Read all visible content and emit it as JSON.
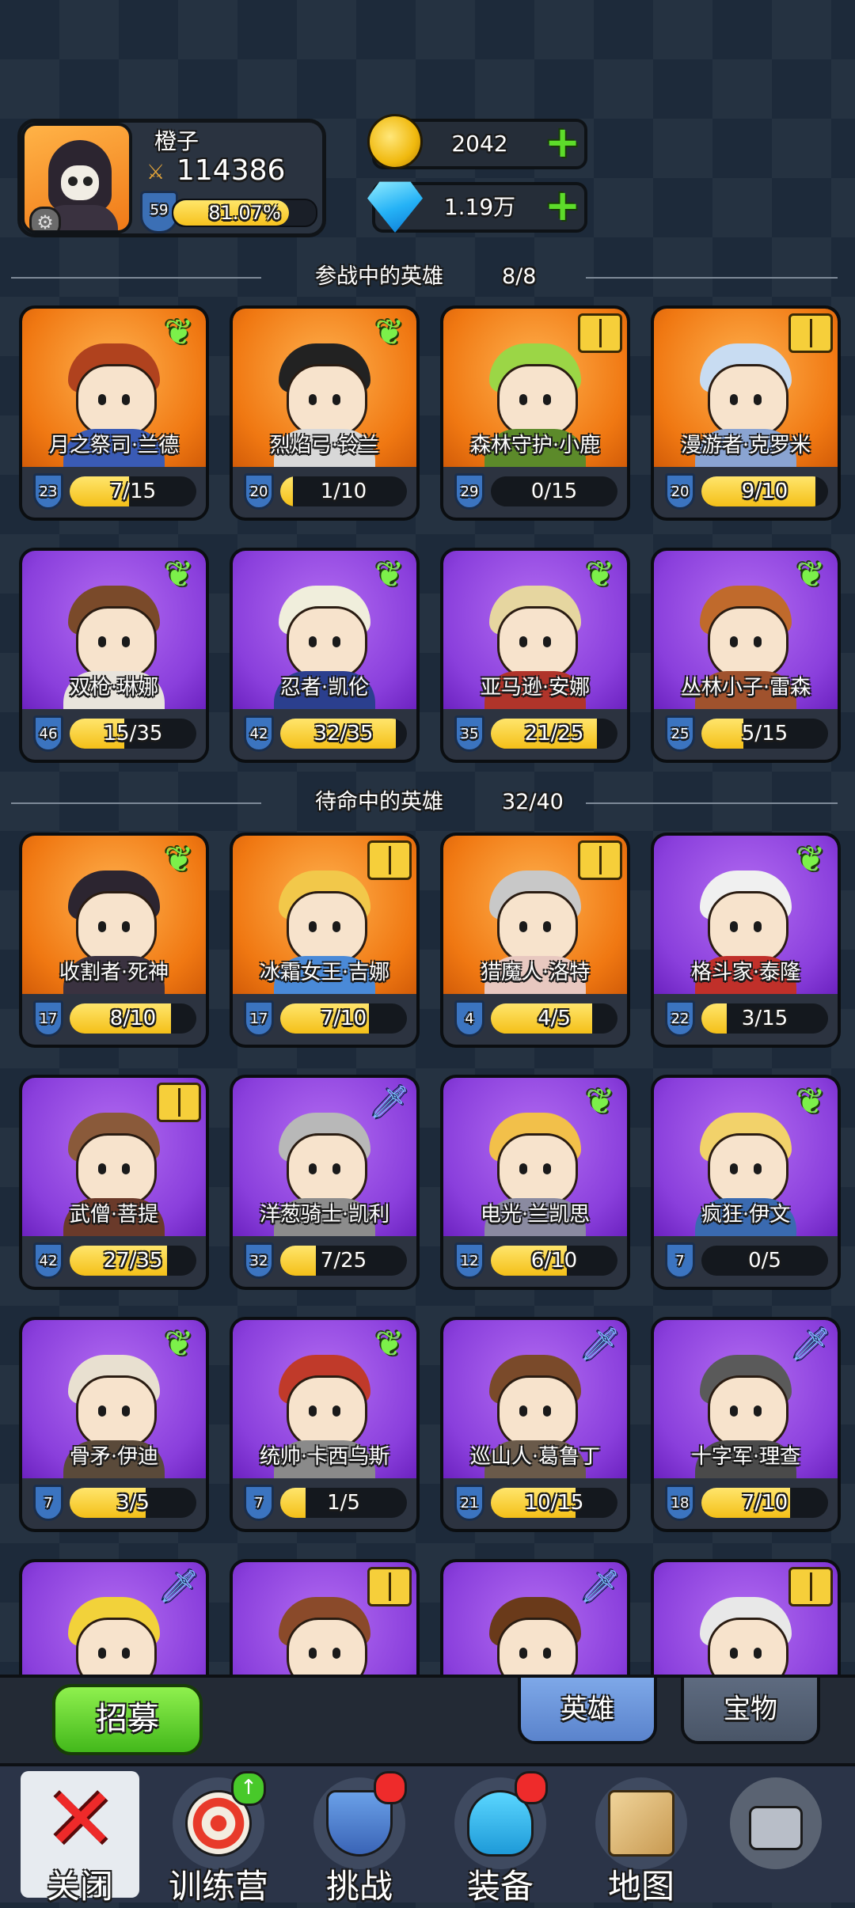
{
  "profile": {
    "name": "橙子",
    "power": "114386",
    "level": "59",
    "xp_percent": "81.07%",
    "xp_fraction": 0.8107
  },
  "currency": {
    "gold": "2042",
    "gems": "1.19万"
  },
  "sections": {
    "active": {
      "title": "参战中的英雄",
      "count": "8/8"
    },
    "standby": {
      "title": "待命中的英雄",
      "count": "32/40"
    }
  },
  "active_heroes": [
    {
      "name": "月之祭司·兰德",
      "level": "23",
      "progress": "7/15",
      "fraction": 0.467,
      "rarity": "orange",
      "badge": "wing-icon",
      "hair": "#b0421e",
      "outfit": "#3a5bb5"
    },
    {
      "name": "烈焰弓·铃兰",
      "level": "20",
      "progress": "1/10",
      "fraction": 0.1,
      "rarity": "orange",
      "badge": "wing-icon",
      "hair": "#222222",
      "outfit": "#d8d8d8"
    },
    {
      "name": "森林守护·小鹿",
      "level": "29",
      "progress": "0/15",
      "fraction": 0.0,
      "rarity": "orange",
      "badge": "book-icon",
      "hair": "#9bd646",
      "outfit": "#5c8a2a"
    },
    {
      "name": "漫游者·克罗米",
      "level": "20",
      "progress": "9/10",
      "fraction": 0.9,
      "rarity": "orange",
      "badge": "book-icon",
      "hair": "#c8dcf2",
      "outfit": "#8aa4d2"
    },
    {
      "name": "双枪·琳娜",
      "level": "46",
      "progress": "15/35",
      "fraction": 0.429,
      "rarity": "purple",
      "badge": "wing-icon",
      "hair": "#7a4a2a",
      "outfit": "#e8e4dc"
    },
    {
      "name": "忍者·凯伦",
      "level": "42",
      "progress": "32/35",
      "fraction": 0.914,
      "rarity": "purple",
      "badge": "wing-icon",
      "hair": "#f0eedc",
      "outfit": "#2b3f8e"
    },
    {
      "name": "亚马逊·安娜",
      "level": "35",
      "progress": "21/25",
      "fraction": 0.84,
      "rarity": "purple",
      "badge": "wing-icon",
      "hair": "#e6d6a0",
      "outfit": "#b0342a"
    },
    {
      "name": "丛林小子·雷森",
      "level": "25",
      "progress": "5/15",
      "fraction": 0.333,
      "rarity": "purple",
      "badge": "wing-icon",
      "hair": "#c06a2c",
      "outfit": "#a0522d"
    }
  ],
  "standby_heroes": [
    {
      "name": "收割者·死神",
      "level": "17",
      "progress": "8/10",
      "fraction": 0.8,
      "rarity": "orange",
      "badge": "wing-icon",
      "hair": "#2c2530",
      "outfit": "#3a3240"
    },
    {
      "name": "冰霜女王·吉娜",
      "level": "17",
      "progress": "7/10",
      "fraction": 0.7,
      "rarity": "orange",
      "badge": "book-icon",
      "hair": "#f2c84a",
      "outfit": "#4a8ad8"
    },
    {
      "name": "猎魔人·洛特",
      "level": "4",
      "progress": "4/5",
      "fraction": 0.8,
      "rarity": "orange",
      "badge": "book-icon",
      "hair": "#c8c8c8",
      "outfit": "#e8c8c0"
    },
    {
      "name": "格斗家·泰隆",
      "level": "22",
      "progress": "3/15",
      "fraction": 0.2,
      "rarity": "purple",
      "badge": "wing-icon",
      "hair": "#f0f0f0",
      "outfit": "#c0302a"
    },
    {
      "name": "武僧·菩提",
      "level": "42",
      "progress": "27/35",
      "fraction": 0.771,
      "rarity": "purple",
      "badge": "book-icon",
      "hair": "#8a5a3a",
      "outfit": "#6a3a2a"
    },
    {
      "name": "洋葱骑士·凯利",
      "level": "32",
      "progress": "7/25",
      "fraction": 0.28,
      "rarity": "purple",
      "badge": "dagger-icon",
      "hair": "#b8b8b8",
      "outfit": "#8c8c8c"
    },
    {
      "name": "电光·兰凯思",
      "level": "12",
      "progress": "6/10",
      "fraction": 0.6,
      "rarity": "purple",
      "badge": "wing-icon",
      "hair": "#f2c04a",
      "outfit": "#8a8aa0"
    },
    {
      "name": "疯狂·伊文",
      "level": "7",
      "progress": "0/5",
      "fraction": 0.0,
      "rarity": "purple",
      "badge": "wing-icon",
      "hair": "#f2d26a",
      "outfit": "#3a6ab0"
    },
    {
      "name": "骨矛·伊迪",
      "level": "7",
      "progress": "3/5",
      "fraction": 0.6,
      "rarity": "purple",
      "badge": "wing-icon",
      "hair": "#e8e0d0",
      "outfit": "#5a4a3a"
    },
    {
      "name": "统帅·卡西乌斯",
      "level": "7",
      "progress": "1/5",
      "fraction": 0.2,
      "rarity": "purple",
      "badge": "wing-icon",
      "hair": "#c03a2a",
      "outfit": "#8a8a8a"
    },
    {
      "name": "巡山人·葛鲁丁",
      "level": "21",
      "progress": "10/15",
      "fraction": 0.667,
      "rarity": "purple",
      "badge": "dagger-icon",
      "hair": "#7a4a2a",
      "outfit": "#6a5a4a"
    },
    {
      "name": "十字军·理查",
      "level": "18",
      "progress": "7/10",
      "fraction": 0.7,
      "rarity": "purple",
      "badge": "dagger-icon",
      "hair": "#5a5a5a",
      "outfit": "#4a4a4a"
    },
    {
      "name": "",
      "level": "",
      "progress": "",
      "fraction": 0,
      "rarity": "purple",
      "badge": "dagger-icon",
      "hair": "#f2d23a",
      "outfit": "#8a8a8a"
    },
    {
      "name": "",
      "level": "",
      "progress": "",
      "fraction": 0,
      "rarity": "purple",
      "badge": "book-icon",
      "hair": "#8a4a2a",
      "outfit": "#d8c0a0"
    },
    {
      "name": "",
      "level": "",
      "progress": "",
      "fraction": 0,
      "rarity": "purple",
      "badge": "dagger-icon",
      "hair": "#6a3a1a",
      "outfit": "#5a5a5a"
    },
    {
      "name": "",
      "level": "",
      "progress": "",
      "fraction": 0,
      "rarity": "purple",
      "badge": "book-icon",
      "hair": "#e8e8e8",
      "outfit": "#2a2a2a"
    }
  ],
  "actions": {
    "recruit": "招募"
  },
  "tabs": {
    "heroes": "英雄",
    "treasure": "宝物"
  },
  "nav": {
    "close": "关闭",
    "training": "训练营",
    "challenge": "挑战",
    "equipment": "装备",
    "map": "地图"
  }
}
